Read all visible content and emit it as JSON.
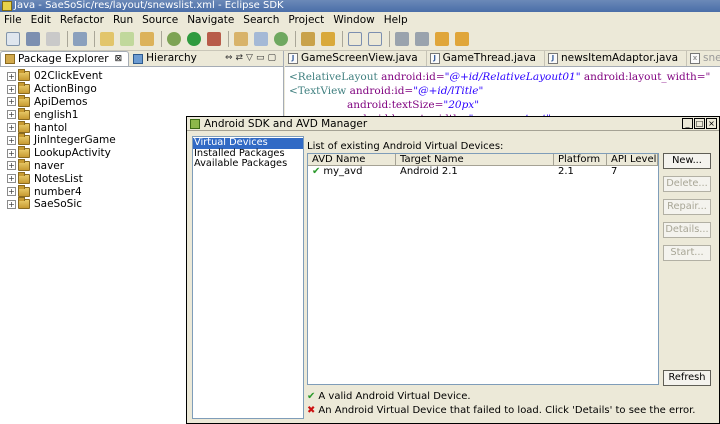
{
  "window": {
    "title": "Java - SaeSoSic/res/layout/snewslist.xml - Eclipse SDK"
  },
  "menu": [
    "File",
    "Edit",
    "Refactor",
    "Run",
    "Source",
    "Navigate",
    "Search",
    "Project",
    "Window",
    "Help"
  ],
  "package_explorer": {
    "tab_label": "Package Explorer",
    "close_glyph": "⊠",
    "hierarchy_label": "Hierarchy",
    "expander_glyph": "+",
    "projects": [
      "02ClickEvent",
      "ActionBingo",
      "ApiDemos",
      "english1",
      "hantol",
      "JinIntegerGame",
      "LookupActivity",
      "naver",
      "NotesList",
      "number4",
      "SaeSoSic"
    ]
  },
  "editor": {
    "tabs": [
      "GameScreenView.java",
      "GameThread.java",
      "newsItemAdaptor.java",
      "snewslist.xml"
    ],
    "code": [
      {
        "tag": "<RelativeLayout",
        "attr": " android:id=",
        "val": "\"@+id/RelativeLayout01\"",
        "attr2": " android:layout_width=\""
      },
      {
        "tag": "<TextView",
        "attr": " android:id=",
        "val": "\"@+id/lTitle\"",
        "attr2": ""
      },
      {
        "tag": "",
        "attr": "android:textSize=",
        "val": "\"20px\"",
        "attr2": ""
      },
      {
        "tag": "",
        "attr": "android:layout_width=",
        "val": "\"wrap_content\"",
        "attr2": ""
      }
    ]
  },
  "avd_manager": {
    "title": "Android SDK and AVD Manager",
    "window_controls": [
      "_",
      "□",
      "×"
    ],
    "nav": [
      "Virtual Devices",
      "Installed Packages",
      "Available Packages"
    ],
    "list_caption": "List of existing Android Virtual Devices:",
    "columns": [
      "AVD Name",
      "Target Name",
      "Platform",
      "API Level"
    ],
    "rows": [
      {
        "name": "my_avd",
        "target": "Android 2.1",
        "platform": "2.1",
        "api": "7"
      }
    ],
    "buttons": [
      "New...",
      "Delete...",
      "Repair...",
      "Details...",
      "Start..."
    ],
    "refresh": "Refresh",
    "legend_valid": "A valid Android Virtual Device.",
    "legend_invalid": "An Android Virtual Device that failed to load. Click 'Details' to see the error."
  },
  "glyphs": {
    "check": "✔",
    "cross": "✖"
  },
  "colors": {
    "selection": "#316ac5",
    "valid": "#2c9a2c",
    "invalid": "#cc1111"
  }
}
